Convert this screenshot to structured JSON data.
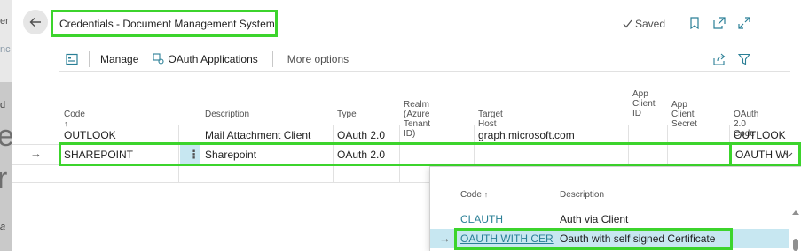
{
  "backdrop": {
    "fragments": [
      "er",
      "nc",
      "d",
      "e",
      "r",
      "a"
    ]
  },
  "header": {
    "title": "Credentials - Document Management System",
    "saved_label": "Saved"
  },
  "actionbar": {
    "manage_label": "Manage",
    "oauth_label": "OAuth Applications",
    "more_label": "More options"
  },
  "grid": {
    "columns": {
      "code": "Code",
      "description": "Description",
      "type": "Type",
      "realm_line1": "Realm (Azure",
      "realm_line2": "Tenant ID)",
      "target_host": "Target Host",
      "app_client_id_line1": "App",
      "app_client_id_line2": "Client",
      "app_client_id_line3": "ID",
      "app_client_secret_line1": "App Client",
      "app_client_secret_line2": "Secret",
      "oauth_code": "OAuth 2.0 Code"
    },
    "rows": [
      {
        "code": "OUTLOOK",
        "description": "Mail Attachment Client",
        "type": "OAuth 2.0",
        "target_host": "graph.microsoft.com",
        "oauth_code": "OUTLOOK"
      },
      {
        "code": "SHAREPOINT",
        "description": "Sharepoint",
        "type": "OAuth 2.0",
        "target_host": "",
        "oauth_code": "OAUTH WI"
      }
    ]
  },
  "lookup": {
    "head_code": "Code",
    "head_description": "Description",
    "rows": [
      {
        "code": "CLAUTH",
        "description": "Auth via Client"
      },
      {
        "code": "OAUTH WITH CER",
        "description": "Oauth with self signed Certificate"
      }
    ]
  },
  "colors": {
    "highlight": "#3cd42c",
    "selected_row": "#c7e7f1",
    "link": "#2a7f96"
  }
}
